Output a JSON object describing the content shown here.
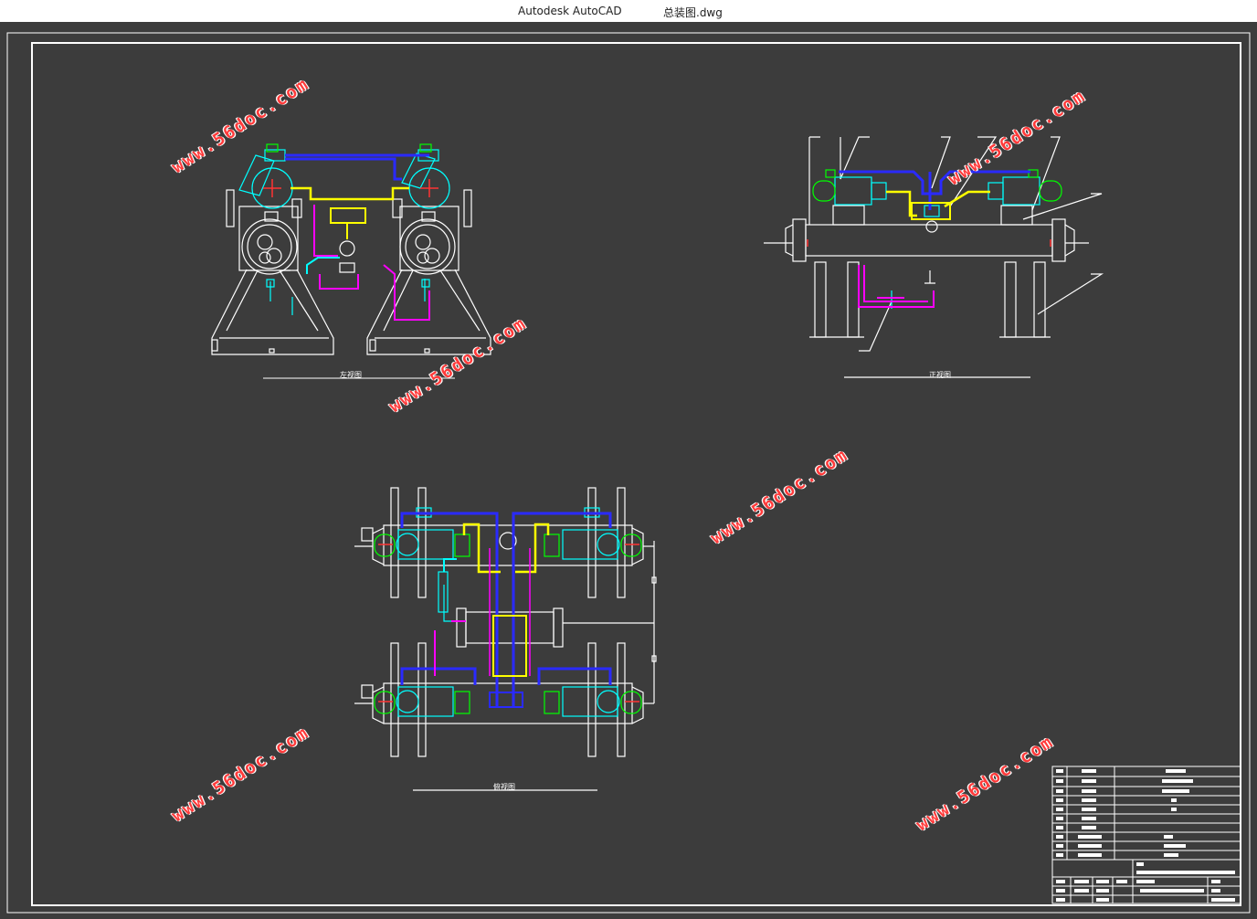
{
  "window": {
    "app_title": "Autodesk AutoCAD",
    "file_name": "总装图.dwg"
  },
  "views": {
    "left_view_label": "左视图",
    "front_view_label": "正视图",
    "top_view_label": "俯视图"
  },
  "watermark_text": "www.56doc.com",
  "colors": {
    "background": "#3c3c3c",
    "frame": "#ffffff",
    "pipe_blue": "#2a2aff",
    "pipe_yellow": "#ffff00",
    "pipe_magenta": "#ff00ff",
    "equipment_cyan": "#00ffff",
    "valve_green": "#00ff00",
    "watermark_red": "#ff3b3b"
  }
}
